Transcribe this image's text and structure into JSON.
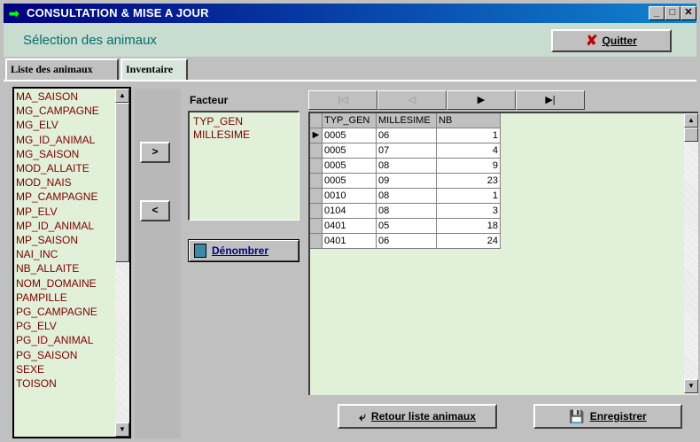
{
  "window": {
    "title": "CONSULTATION & MISE A JOUR",
    "minimize": "_",
    "maximize": "□",
    "close": "✕"
  },
  "header": {
    "section_title": "Sélection des animaux",
    "quit_label": "Quitter"
  },
  "tabs": [
    {
      "label": "Liste des animaux"
    },
    {
      "label": "Inventaire"
    }
  ],
  "animal_list": {
    "items": [
      "MA_SAISON",
      "MG_CAMPAGNE",
      "MG_ELV",
      "MG_ID_ANIMAL",
      "MG_SAISON",
      "MOD_ALLAITE",
      "MOD_NAIS",
      "MP_CAMPAGNE",
      "MP_ELV",
      "MP_ID_ANIMAL",
      "MP_SAISON",
      "NAI_INC",
      "NB_ALLAITE",
      "NOM_DOMAINE",
      "PAMPILLE",
      "PG_CAMPAGNE",
      "PG_ELV",
      "PG_ID_ANIMAL",
      "PG_SAISON",
      "SEXE",
      "TOISON"
    ]
  },
  "move_buttons": {
    "add": ">",
    "remove": "<"
  },
  "facteur": {
    "label": "Facteur",
    "items": [
      "TYP_GEN",
      "MILLESIME"
    ],
    "count_button": "Dénombrer"
  },
  "navigator": {
    "first": "|◁",
    "prev": "◁",
    "next": "▶",
    "last": "▶|"
  },
  "grid": {
    "columns": [
      "TYP_GEN",
      "MILLESIME",
      "NB"
    ],
    "rows": [
      [
        "0005",
        "06",
        "1"
      ],
      [
        "0005",
        "07",
        "4"
      ],
      [
        "0005",
        "08",
        "9"
      ],
      [
        "0005",
        "09",
        "23"
      ],
      [
        "0010",
        "08",
        "1"
      ],
      [
        "0104",
        "08",
        "3"
      ],
      [
        "0401",
        "05",
        "18"
      ],
      [
        "0401",
        "06",
        "24"
      ]
    ],
    "current_row_marker": "▶"
  },
  "footer": {
    "back_label": "Retour liste animaux",
    "save_label": "Enregistrer"
  },
  "colors": {
    "title_bar": "#000080",
    "panel_bg": "#e1f0d9",
    "list_text": "#7f0000",
    "section_title": "#006f6f"
  }
}
